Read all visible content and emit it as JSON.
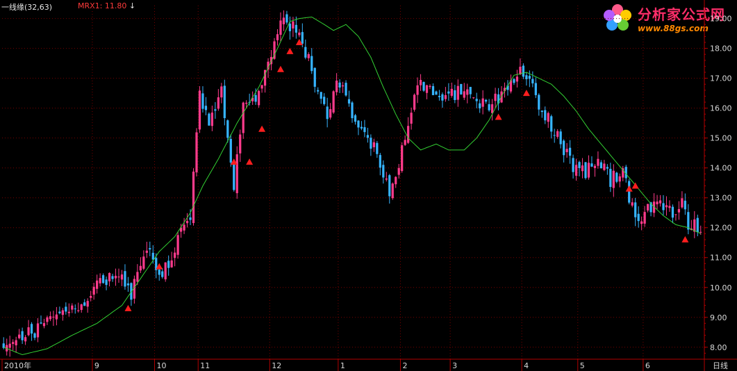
{
  "header": {
    "indicator_title": "一线缘(32,63)",
    "indicator_label": "MRX1:",
    "indicator_value": "11.80",
    "arrow_glyph": "↓"
  },
  "logo": {
    "name": "分析家公式网",
    "url": "www.88gs.com",
    "icon": "flower-icon"
  },
  "colors": {
    "background": "#000000",
    "up": "#ff3b8c",
    "down": "#36b4ff",
    "ma_line": "#33d033",
    "signal": "#ff1e1e",
    "axis": "#b30000",
    "grid": "#7a0000",
    "label": "#d9d9d9"
  },
  "chart_data": {
    "type": "candlestick",
    "period_label": "日线",
    "ylim": [
      7.6,
      19.2
    ],
    "y_ticks": [
      8.0,
      9.0,
      10.0,
      11.0,
      12.0,
      13.0,
      14.0,
      15.0,
      16.0,
      17.0,
      18.0,
      19.0
    ],
    "y_tick_labels": [
      "8.00",
      "9.00",
      "10.00",
      "11.00",
      "12.00",
      "13.00",
      "14.00",
      "15.00",
      "16.00",
      "17.00",
      "18.00",
      "19.00"
    ],
    "x_month_labels": [
      {
        "index": 0,
        "label": "2010年"
      },
      {
        "index": 29,
        "label": "9"
      },
      {
        "index": 49,
        "label": "10"
      },
      {
        "index": 63,
        "label": "11"
      },
      {
        "index": 86,
        "label": "12"
      },
      {
        "index": 108,
        "label": "1"
      },
      {
        "index": 128,
        "label": "2"
      },
      {
        "index": 144,
        "label": "3"
      },
      {
        "index": 167,
        "label": "4"
      },
      {
        "index": 185,
        "label": "5"
      },
      {
        "index": 206,
        "label": "6"
      }
    ],
    "series": [
      {
        "price_path": [
          [
            0,
            8.1
          ],
          [
            10,
            8.5
          ],
          [
            18,
            9.0
          ],
          [
            27,
            9.4
          ],
          [
            31,
            10.2
          ],
          [
            38,
            10.4
          ],
          [
            41,
            9.8
          ],
          [
            46,
            11.3
          ],
          [
            51,
            10.4
          ],
          [
            56,
            11.6
          ],
          [
            60,
            12.3
          ],
          [
            63,
            16.5
          ],
          [
            66,
            15.3
          ],
          [
            70,
            16.7
          ],
          [
            74,
            13.4
          ],
          [
            77,
            16.2
          ],
          [
            82,
            16.5
          ],
          [
            86,
            17.9
          ],
          [
            90,
            19.0
          ],
          [
            94,
            18.6
          ],
          [
            98,
            17.6
          ],
          [
            104,
            15.6
          ],
          [
            107,
            17.0
          ],
          [
            115,
            15.2
          ],
          [
            120,
            14.6
          ],
          [
            124,
            13.2
          ],
          [
            129,
            14.9
          ],
          [
            133,
            16.9
          ],
          [
            138,
            16.6
          ],
          [
            144,
            16.4
          ],
          [
            148,
            16.6
          ],
          [
            152,
            16.0
          ],
          [
            157,
            16.2
          ],
          [
            163,
            16.8
          ],
          [
            167,
            17.3
          ],
          [
            170,
            16.6
          ],
          [
            174,
            15.8
          ],
          [
            178,
            15.0
          ],
          [
            183,
            14.1
          ],
          [
            187,
            13.8
          ],
          [
            191,
            14.3
          ],
          [
            195,
            13.6
          ],
          [
            199,
            13.9
          ],
          [
            203,
            12.2
          ],
          [
            207,
            12.6
          ],
          [
            211,
            12.8
          ],
          [
            215,
            12.5
          ],
          [
            218,
            12.8
          ],
          [
            220,
            12.1
          ],
          [
            223,
            12.1
          ]
        ]
      },
      {
        "name": "MRX1",
        "values_path": [
          [
            0,
            8.0
          ],
          [
            6,
            7.75
          ],
          [
            14,
            7.95
          ],
          [
            22,
            8.4
          ],
          [
            30,
            8.8
          ],
          [
            38,
            9.4
          ],
          [
            44,
            10.3
          ],
          [
            50,
            11.2
          ],
          [
            55,
            11.7
          ],
          [
            60,
            12.5
          ],
          [
            64,
            13.4
          ],
          [
            69,
            14.3
          ],
          [
            75,
            15.5
          ],
          [
            82,
            16.7
          ],
          [
            88,
            18.0
          ],
          [
            92,
            18.9
          ],
          [
            95,
            19.0
          ],
          [
            99,
            19.05
          ],
          [
            103,
            18.8
          ],
          [
            106,
            18.6
          ],
          [
            110,
            18.8
          ],
          [
            114,
            18.4
          ],
          [
            118,
            17.7
          ],
          [
            122,
            16.7
          ],
          [
            126,
            15.8
          ],
          [
            130,
            15.0
          ],
          [
            134,
            14.6
          ],
          [
            139,
            14.8
          ],
          [
            143,
            14.6
          ],
          [
            148,
            14.6
          ],
          [
            152,
            15.0
          ],
          [
            156,
            15.6
          ],
          [
            160,
            16.4
          ],
          [
            164,
            17.1
          ],
          [
            168,
            17.2
          ],
          [
            172,
            17.0
          ],
          [
            176,
            16.8
          ],
          [
            180,
            16.4
          ],
          [
            184,
            15.9
          ],
          [
            188,
            15.3
          ],
          [
            192,
            14.8
          ],
          [
            196,
            14.3
          ],
          [
            200,
            13.8
          ],
          [
            204,
            13.3
          ],
          [
            208,
            12.8
          ],
          [
            212,
            12.4
          ],
          [
            216,
            12.1
          ],
          [
            220,
            12.0
          ],
          [
            224,
            11.8
          ]
        ]
      }
    ],
    "signals": [
      {
        "index": 40,
        "price": 9.3
      },
      {
        "index": 50,
        "price": 10.7
      },
      {
        "index": 74,
        "price": 14.2
      },
      {
        "index": 79,
        "price": 14.2
      },
      {
        "index": 83,
        "price": 15.3
      },
      {
        "index": 89,
        "price": 17.3
      },
      {
        "index": 92,
        "price": 17.9
      },
      {
        "index": 95,
        "price": 18.2
      },
      {
        "index": 159,
        "price": 15.7
      },
      {
        "index": 168,
        "price": 16.5
      },
      {
        "index": 201,
        "price": 13.3
      },
      {
        "index": 203,
        "price": 13.4
      },
      {
        "index": 219,
        "price": 11.6
      }
    ]
  }
}
